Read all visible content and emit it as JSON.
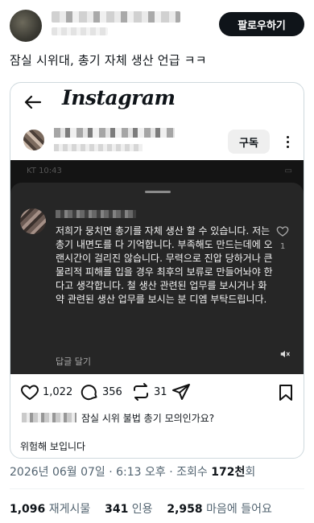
{
  "tweet": {
    "follow_label": "팔로우하기",
    "text": "잠실 시위대, 총기 자체 생산 언급 ㅋㅋ",
    "date": "2026년 06월 07일 · 6:13 오후 · 조회수",
    "views": "172천",
    "views_suffix": "회"
  },
  "instagram": {
    "logo": "Instagram",
    "subscribe_label": "구독",
    "status_time": "KT 10:43",
    "comment": {
      "text": "저희가 뭉치면 총기를 자체 생산 할 수 있습니다. 저는 총기 내면도를 다 기억합니다. 부족해도 만드는데에 오랜시간이 걸리진 않습니다. 무력으로 진압 당하거나 큰 물리적 피해를 입을 경우 최후의 보류로 만들어놔야 한다고 생각합니다. 철 생산 관련된 업무를 보시거나 화약 관련된 생산 업무를 보시는 분 디엠 부탁드립니다.",
      "reply_label": "답글 달기",
      "like_count": "1"
    },
    "actions": {
      "likes": "1,022",
      "comments": "356",
      "reposts": "31"
    },
    "caption": "잠실 시위 불법 총기 모의인가요?",
    "comment_preview": "위험해 보입니다"
  },
  "stats": {
    "retweets_count": "1,096",
    "retweets_label": "재게시물",
    "quotes_count": "341",
    "quotes_label": "인용",
    "likes_count": "2,958",
    "likes_label": "마음에 들어요"
  }
}
